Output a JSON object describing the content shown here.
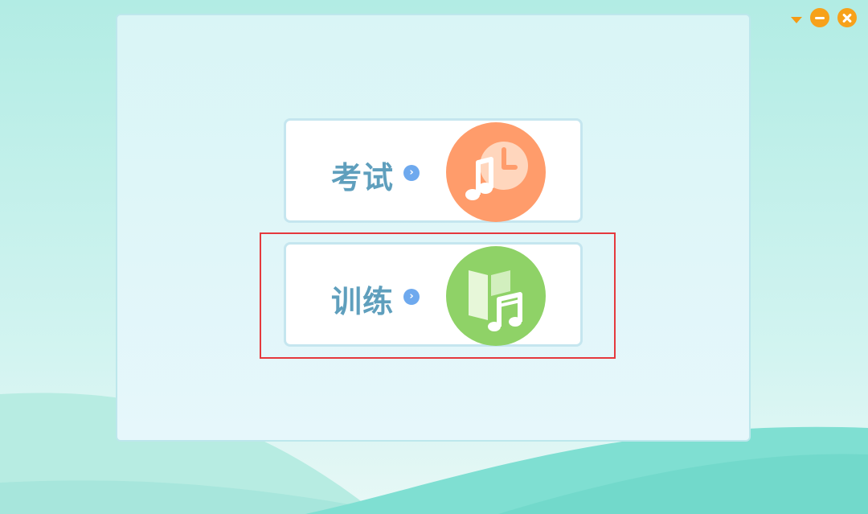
{
  "window_controls": {
    "dropdown_icon": "triangle-down-icon",
    "minimize_icon": "minus-circle-icon",
    "close_icon": "x-circle-icon",
    "accent": "#f7a11a"
  },
  "cards": {
    "exam": {
      "label": "考试",
      "arrow": "›",
      "icon": "music-clock-icon",
      "color": "#ff9c6b"
    },
    "train": {
      "label": "训练",
      "arrow": "›",
      "icon": "music-book-icon",
      "color": "#8fd267"
    }
  },
  "colors": {
    "label": "#5f9fbd",
    "arrow_dot": "#6ea9ee",
    "highlight": "#e5393d"
  }
}
